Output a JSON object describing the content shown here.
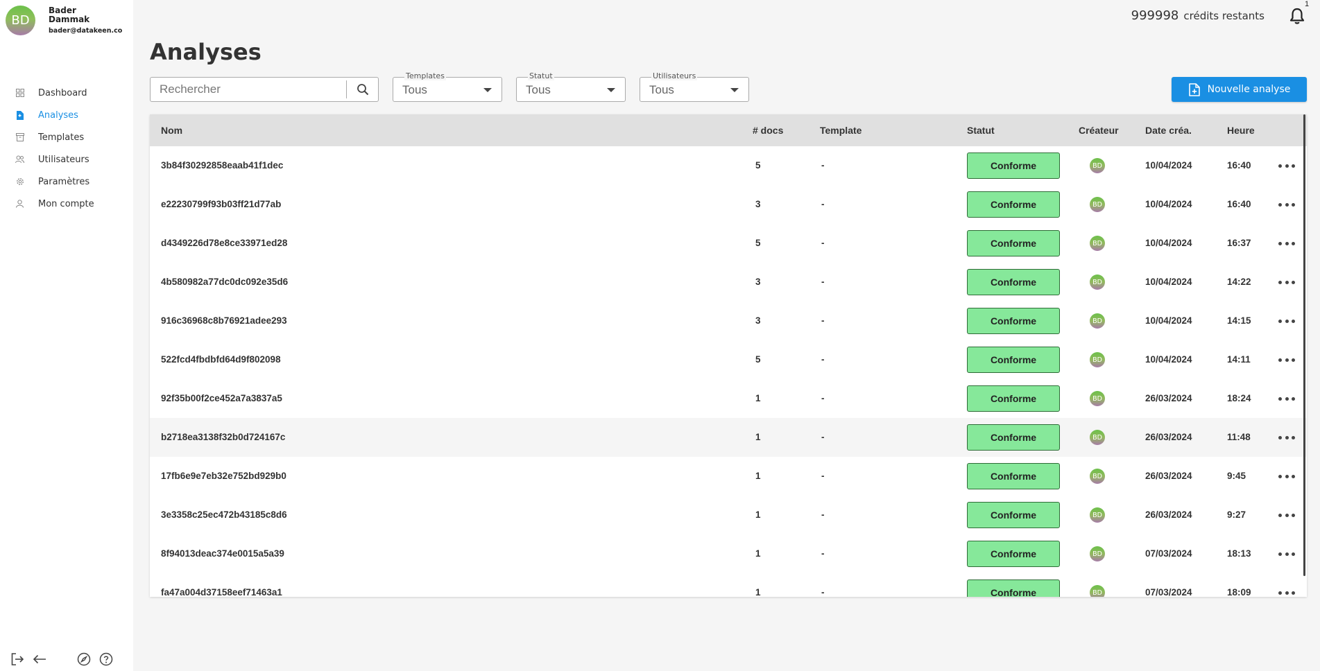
{
  "user": {
    "initials": "BD",
    "name": "Bader Dammak",
    "email": "bader@datakeen.co"
  },
  "nav": [
    {
      "label": "Dashboard",
      "icon": "grid-icon",
      "active": false
    },
    {
      "label": "Analyses",
      "icon": "document-icon",
      "active": true
    },
    {
      "label": "Templates",
      "icon": "archive-icon",
      "active": false
    },
    {
      "label": "Utilisateurs",
      "icon": "users-icon",
      "active": false
    },
    {
      "label": "Paramètres",
      "icon": "gear-icon",
      "active": false
    },
    {
      "label": "Mon compte",
      "icon": "person-icon",
      "active": false
    }
  ],
  "header": {
    "credits_value": "999998",
    "credits_label": "crédits restants",
    "notifications_count": "1"
  },
  "page": {
    "title": "Analyses"
  },
  "filters": {
    "search_placeholder": "Rechercher",
    "templates": {
      "label": "Templates",
      "value": "Tous"
    },
    "statut": {
      "label": "Statut",
      "value": "Tous"
    },
    "utilisateurs": {
      "label": "Utilisateurs",
      "value": "Tous"
    }
  },
  "actions": {
    "new_analysis": "Nouvelle analyse"
  },
  "table": {
    "columns": {
      "nom": "Nom",
      "docs": "# docs",
      "template": "Template",
      "statut": "Statut",
      "createur": "Créateur",
      "date": "Date créa.",
      "heure": "Heure"
    },
    "rows": [
      {
        "nom": "3b84f30292858eaab41f1dec",
        "docs": "5",
        "template": "-",
        "statut": "Conforme",
        "createur": "BD",
        "date": "10/04/2024",
        "heure": "16:40"
      },
      {
        "nom": "e22230799f93b03ff21d77ab",
        "docs": "3",
        "template": "-",
        "statut": "Conforme",
        "createur": "BD",
        "date": "10/04/2024",
        "heure": "16:40"
      },
      {
        "nom": "d4349226d78e8ce33971ed28",
        "docs": "5",
        "template": "-",
        "statut": "Conforme",
        "createur": "BD",
        "date": "10/04/2024",
        "heure": "16:37"
      },
      {
        "nom": "4b580982a77dc0dc092e35d6",
        "docs": "3",
        "template": "-",
        "statut": "Conforme",
        "createur": "BD",
        "date": "10/04/2024",
        "heure": "14:22"
      },
      {
        "nom": "916c36968c8b76921adee293",
        "docs": "3",
        "template": "-",
        "statut": "Conforme",
        "createur": "BD",
        "date": "10/04/2024",
        "heure": "14:15"
      },
      {
        "nom": "522fcd4fbdbfd64d9f802098",
        "docs": "5",
        "template": "-",
        "statut": "Conforme",
        "createur": "BD",
        "date": "10/04/2024",
        "heure": "14:11"
      },
      {
        "nom": "92f35b00f2ce452a7a3837a5",
        "docs": "1",
        "template": "-",
        "statut": "Conforme",
        "createur": "BD",
        "date": "26/03/2024",
        "heure": "18:24"
      },
      {
        "nom": "b2718ea3138f32b0d724167c",
        "docs": "1",
        "template": "-",
        "statut": "Conforme",
        "createur": "BD",
        "date": "26/03/2024",
        "heure": "11:48"
      },
      {
        "nom": "17fb6e9e7eb32e752bd929b0",
        "docs": "1",
        "template": "-",
        "statut": "Conforme",
        "createur": "BD",
        "date": "26/03/2024",
        "heure": "9:45"
      },
      {
        "nom": "3e3358c25ec472b43185c8d6",
        "docs": "1",
        "template": "-",
        "statut": "Conforme",
        "createur": "BD",
        "date": "26/03/2024",
        "heure": "9:27"
      },
      {
        "nom": "8f94013deac374e0015a5a39",
        "docs": "1",
        "template": "-",
        "statut": "Conforme",
        "createur": "BD",
        "date": "07/03/2024",
        "heure": "18:13"
      },
      {
        "nom": "fa47a004d37158eef71463a1",
        "docs": "1",
        "template": "-",
        "statut": "Conforme",
        "createur": "BD",
        "date": "07/03/2024",
        "heure": "18:09"
      }
    ]
  },
  "colors": {
    "accent": "#1a8fe3",
    "status_bg": "#86e89a",
    "status_border": "#2d6b36",
    "page_bg": "#f5f5f5",
    "header_bg": "#e0e0e0"
  },
  "bottom_icons": [
    "logout-icon",
    "back-arrow-icon",
    "compass-icon",
    "help-icon"
  ]
}
